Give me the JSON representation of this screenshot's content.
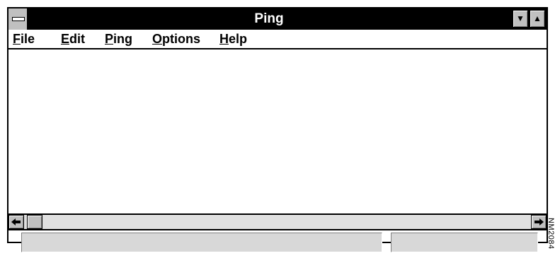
{
  "window": {
    "title": "Ping"
  },
  "titlebar": {
    "system_menu_icon": "system-menu-icon",
    "minimize_icon": "minimize-arrow-icon",
    "maximize_icon": "maximize-arrow-icon",
    "minimize_glyph": "▼",
    "maximize_glyph": "▲"
  },
  "menubar": {
    "items": [
      {
        "accel": "F",
        "rest": "ile"
      },
      {
        "accel": "E",
        "rest": "dit"
      },
      {
        "accel": "P",
        "rest": "ing"
      },
      {
        "accel": "O",
        "rest": "ptions"
      },
      {
        "accel": "H",
        "rest": "elp"
      }
    ]
  },
  "scrollbar": {
    "left_glyph": "◆",
    "right_glyph": "➔",
    "left_icon": "scroll-left-arrow-icon",
    "right_icon": "scroll-right-arrow-icon"
  },
  "status": {
    "pane1": "",
    "pane2": ""
  },
  "figure_label": "NM2084",
  "colors": {
    "titlebar_bg": "#000000",
    "titlebar_text": "#ffffff",
    "chrome_gray": "#c0c0c0"
  }
}
